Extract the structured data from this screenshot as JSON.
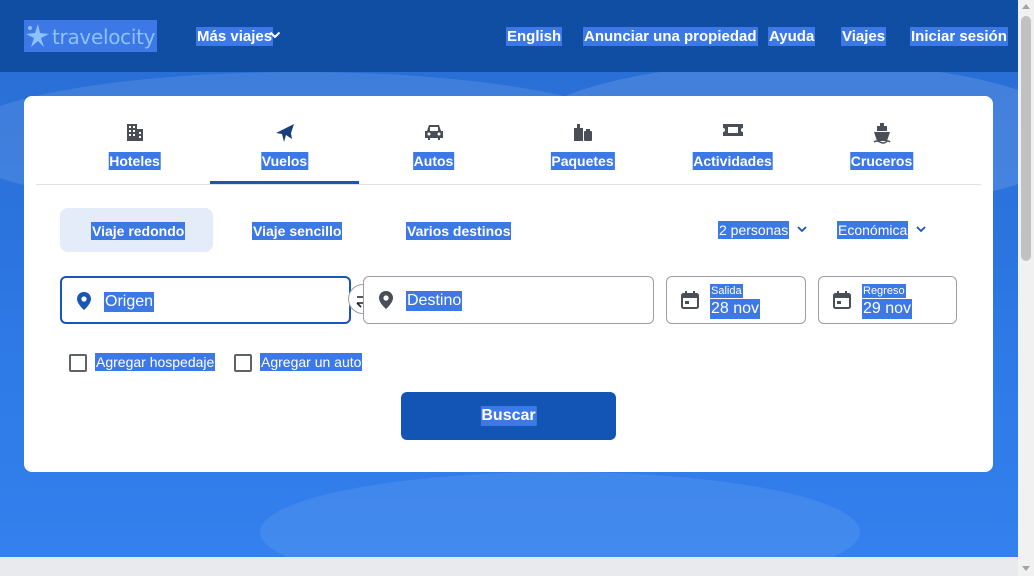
{
  "header": {
    "logo_text": "travelocity",
    "more_trips": "Más viajes",
    "nav": [
      "English",
      "Anunciar una propiedad",
      "Ayuda",
      "Viajes",
      "Iniciar sesión"
    ]
  },
  "tabs": [
    {
      "label": "Hoteles",
      "icon": "building-icon"
    },
    {
      "label": "Vuelos",
      "icon": "plane-icon",
      "active": true
    },
    {
      "label": "Autos",
      "icon": "car-icon"
    },
    {
      "label": "Paquetes",
      "icon": "packages-icon"
    },
    {
      "label": "Actividades",
      "icon": "ticket-icon"
    },
    {
      "label": "Cruceros",
      "icon": "cruise-icon"
    }
  ],
  "trip_types": [
    "Viaje redondo",
    "Viaje sencillo",
    "Varios destinos"
  ],
  "travelers": "2 personas",
  "cabin_class": "Económica",
  "fields": {
    "origin_placeholder": "Origen",
    "destination_placeholder": "Destino",
    "departure_label": "Salida",
    "departure_value": "28 nov",
    "return_label": "Regreso",
    "return_value": "29 nov"
  },
  "addons": [
    "Agregar hospedaje",
    "Agregar un auto"
  ],
  "search_label": "Buscar",
  "colors": {
    "header_bg": "#0f4ea3",
    "primary": "#1255b5",
    "selection_highlight": "#3c78e6"
  }
}
